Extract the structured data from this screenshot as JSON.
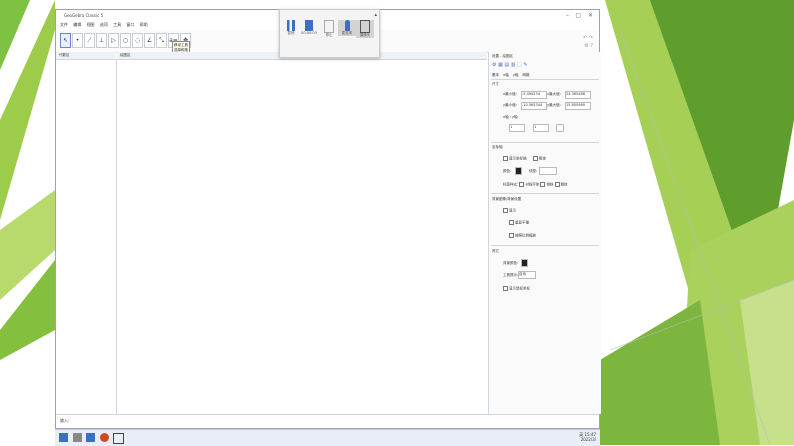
{
  "window": {
    "title": "GeoGebra Classic 5",
    "menu": [
      "文件",
      "编辑",
      "视图",
      "选项",
      "工具",
      "窗口",
      "帮助"
    ]
  },
  "toolbar": {
    "tooltip_title": "移动工具",
    "tooltip_desc": "选择和拖动"
  },
  "panels": {
    "algebra_title": "代数区",
    "graphics_title": "绘图区"
  },
  "settings": {
    "header": "设置 - 绘图区",
    "tabs": [
      "基本",
      "x轴",
      "y轴",
      "网格"
    ],
    "section_dimensions": "尺寸",
    "xmin_label": "x最小值:",
    "xmin_value": "-5.490234",
    "xmax_label": "x最大值:",
    "xmax_value": "24.365488",
    "ymin_label": "y最小值:",
    "ymin_value": "-10.565344",
    "ymax_label": "y最大值:",
    "ymax_value": "15.850989",
    "ratio_label": "x轴 : y轴",
    "ratio_x": "1",
    "ratio_y": "1",
    "section_axes": "坐标轴",
    "show_axes": "显示坐标轴",
    "bold": "粗体",
    "color_label": "颜色:",
    "line_style_label": "线型:",
    "axis_label_label": "标签样式:",
    "serif": "衬线字体",
    "italic": "倾斜",
    "bold2": "粗体",
    "section_background": "背景图像/背景设置",
    "show_bg": "显示",
    "bg_opt1": "重复平铺",
    "bg_opt2": "按照比例缩放",
    "section_misc": "其它",
    "bg_color": "背景颜色:",
    "tooltips": "工具提示:",
    "tooltips_value": "自动",
    "show_mouse": "显示鼠标坐标"
  },
  "input_bar": {
    "label": "输入:"
  },
  "recorder": {
    "items": [
      "暂停",
      "00:00:03",
      "停止",
      "麦克风",
      "摄像头"
    ]
  },
  "taskbar": {
    "time": "15:47",
    "date": "2022/3/",
    "lang": "英"
  }
}
